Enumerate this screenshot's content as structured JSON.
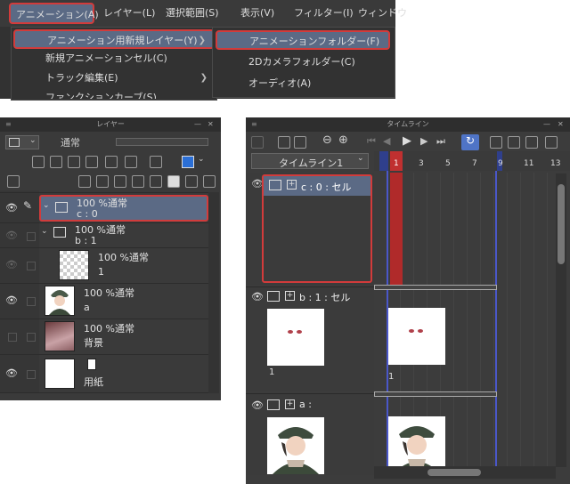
{
  "menu": {
    "bar_items": [
      "アニメーション(A)",
      "レイヤー(L)",
      "選択範囲(S)",
      "表示(V)",
      "フィルター(I)",
      "ウィンドウ"
    ],
    "submenu": [
      "アニメーション用新規レイヤー(Y)",
      "新規アニメーションセル(C)",
      "トラック編集(E)",
      "ファンクションカーブ(S)"
    ],
    "submenu2": [
      "アニメーションフォルダー(F)",
      "2Dカメラフォルダー(C)",
      "オーディオ(A)"
    ]
  },
  "layer_panel": {
    "title": "レイヤー",
    "blend_mode": "通常",
    "layers": [
      {
        "line1": "100 %通常",
        "line2": "c : 0"
      },
      {
        "line1": "100 %通常",
        "line2": "b : 1"
      },
      {
        "line1": "100 %通常",
        "line2": "1"
      },
      {
        "line1": "100 %通常",
        "line2": "a"
      },
      {
        "line1": "100 %通常",
        "line2": "背景"
      },
      {
        "line1": "",
        "line2": "用紙"
      }
    ]
  },
  "timeline": {
    "title": "タイムライン",
    "select": "タイムライン1",
    "ruler": [
      "1",
      "3",
      "5",
      "7",
      "9",
      "11",
      "13"
    ],
    "tracks": [
      {
        "name": "c : 0 : セル"
      },
      {
        "name": "b : 1 : セル",
        "cell": "1"
      },
      {
        "name": "a :"
      }
    ],
    "frame_cell": "1",
    "accent": "#c03030"
  }
}
